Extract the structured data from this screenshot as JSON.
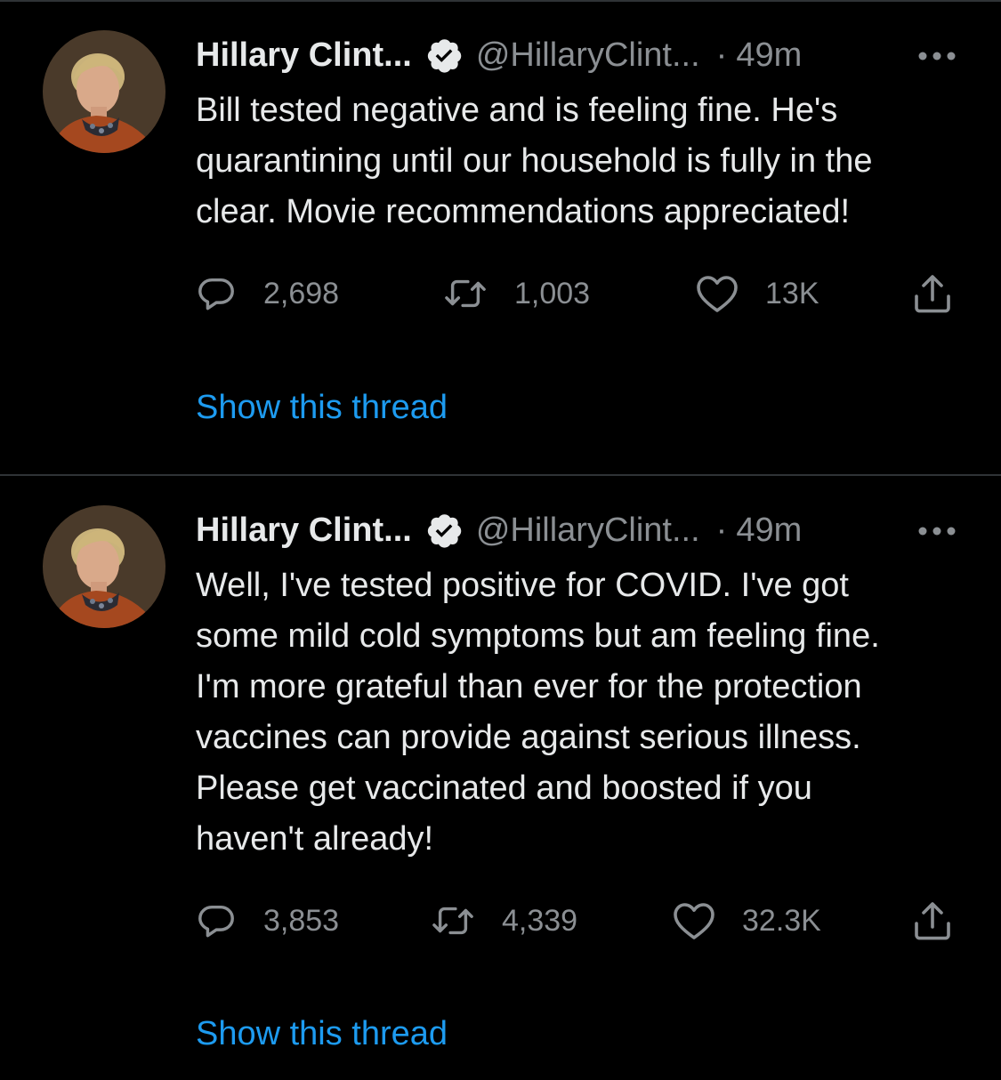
{
  "colors": {
    "background": "#000000",
    "text_primary": "#e7e9ea",
    "text_secondary": "#8b8f93",
    "link": "#1d9bf0",
    "divider": "#2f3336"
  },
  "tweets": [
    {
      "author_name": "Hillary Clint...",
      "verified_icon": "verified-badge-icon",
      "handle": "@HillaryClint...",
      "separator": "·",
      "time": "49m",
      "lines": [
        "Bill tested negative and is feeling fine. He's",
        "quarantining until our household is fully in the",
        "clear. Movie recommendations appreciated!"
      ],
      "reply_count": "2,698",
      "retweet_count": "1,003",
      "like_count": "13K",
      "show_thread": "Show this thread"
    },
    {
      "author_name": "Hillary Clint...",
      "verified_icon": "verified-badge-icon",
      "handle": "@HillaryClint...",
      "separator": "·",
      "time": "49m",
      "lines": [
        "Well, I've tested positive for COVID. I've got",
        "some mild cold symptoms but am feeling fine.",
        "I'm more grateful than ever for the protection",
        "vaccines can provide against serious illness.",
        "Please get vaccinated and boosted if you",
        "haven't already!"
      ],
      "reply_count": "3,853",
      "retweet_count": "4,339",
      "like_count": "32.3K",
      "show_thread": "Show this thread"
    }
  ]
}
